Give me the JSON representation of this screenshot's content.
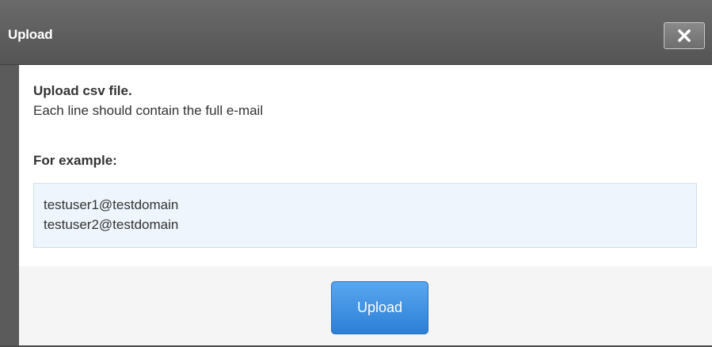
{
  "dialog": {
    "title": "Upload",
    "close_icon": "close-icon",
    "heading": "Upload csv file.",
    "description": "Each line should contain the full e-mail",
    "example_label": "For example:",
    "example_lines": [
      "testuser1@testdomain",
      "testuser2@testdomain"
    ],
    "upload_label": "Upload"
  }
}
